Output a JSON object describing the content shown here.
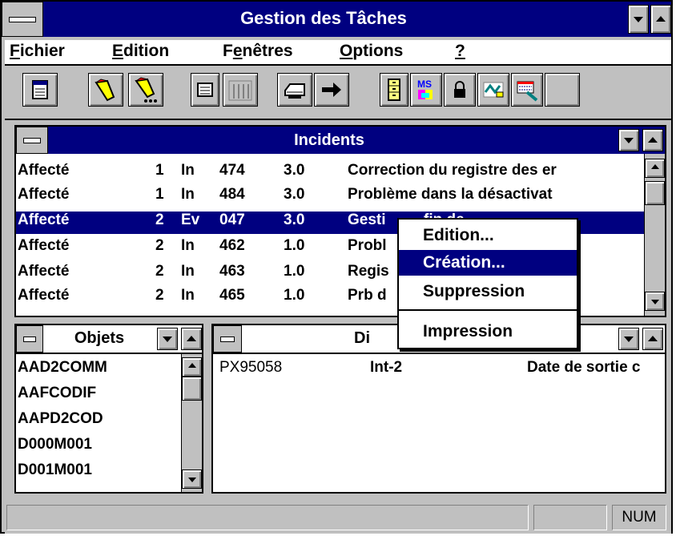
{
  "app": {
    "title": "Gestion des Tâches"
  },
  "menu": [
    {
      "pre": "",
      "ul": "F",
      "post": "ichier"
    },
    {
      "pre": "",
      "ul": "E",
      "post": "dition"
    },
    {
      "pre": "F",
      "ul": "e",
      "post": "nêtres"
    },
    {
      "pre": "",
      "ul": "O",
      "post": "ptions"
    },
    {
      "pre": "",
      "ul": "?",
      "post": ""
    }
  ],
  "toolbar": {
    "icons": [
      "window-list-icon",
      "flashlight-icon",
      "flashlight-more-icon",
      "calculator-icon",
      "bar-chart-icon",
      "printer-icon",
      "arrow-right-icon",
      "file-cabinet-icon",
      "ms-office-icon",
      "lock-icon",
      "mail-tool-icon",
      "keyboard-tool-icon",
      "blank-button"
    ]
  },
  "incidents": {
    "title": "Incidents",
    "rows": [
      {
        "status": "Affecté",
        "num": "1",
        "type": "In",
        "id": "474",
        "ver": "3.0",
        "desc": "Correction du registre des er"
      },
      {
        "status": "Affecté",
        "num": "1",
        "type": "In",
        "id": "484",
        "ver": "3.0",
        "desc": "Problème dans la désactivat"
      },
      {
        "status": "Affecté",
        "num": "2",
        "type": "Ev",
        "id": "047",
        "ver": "3.0",
        "desc": "Gesti         fin de"
      },
      {
        "status": "Affecté",
        "num": "2",
        "type": "In",
        "id": "462",
        "ver": "1.0",
        "desc": "Probl               mand"
      },
      {
        "status": "Affecté",
        "num": "2",
        "type": "In",
        "id": "463",
        "ver": "1.0",
        "desc": "Regis               n repri"
      },
      {
        "status": "Affecté",
        "num": "2",
        "type": "In",
        "id": "465",
        "ver": "1.0",
        "desc": "Prb d                gle de"
      }
    ],
    "selected_index": 2
  },
  "objets": {
    "title": "Objets",
    "items": [
      "AAD2COMM",
      "AAFCODIF",
      "AAPD2COD",
      "D000M001",
      "D001M001"
    ]
  },
  "detail": {
    "title": "Di",
    "row": {
      "code": "PX95058",
      "type": "Int-2",
      "desc": "Date de sortie c"
    }
  },
  "context_menu": {
    "items": [
      "Edition...",
      "Création...",
      "Suppression",
      "Impression"
    ],
    "highlighted_index": 1
  },
  "statusbar": {
    "num": "NUM"
  },
  "colors": {
    "titlebar": "#000080",
    "face": "#c0c0c0",
    "highlight_text": "#ffffff"
  }
}
